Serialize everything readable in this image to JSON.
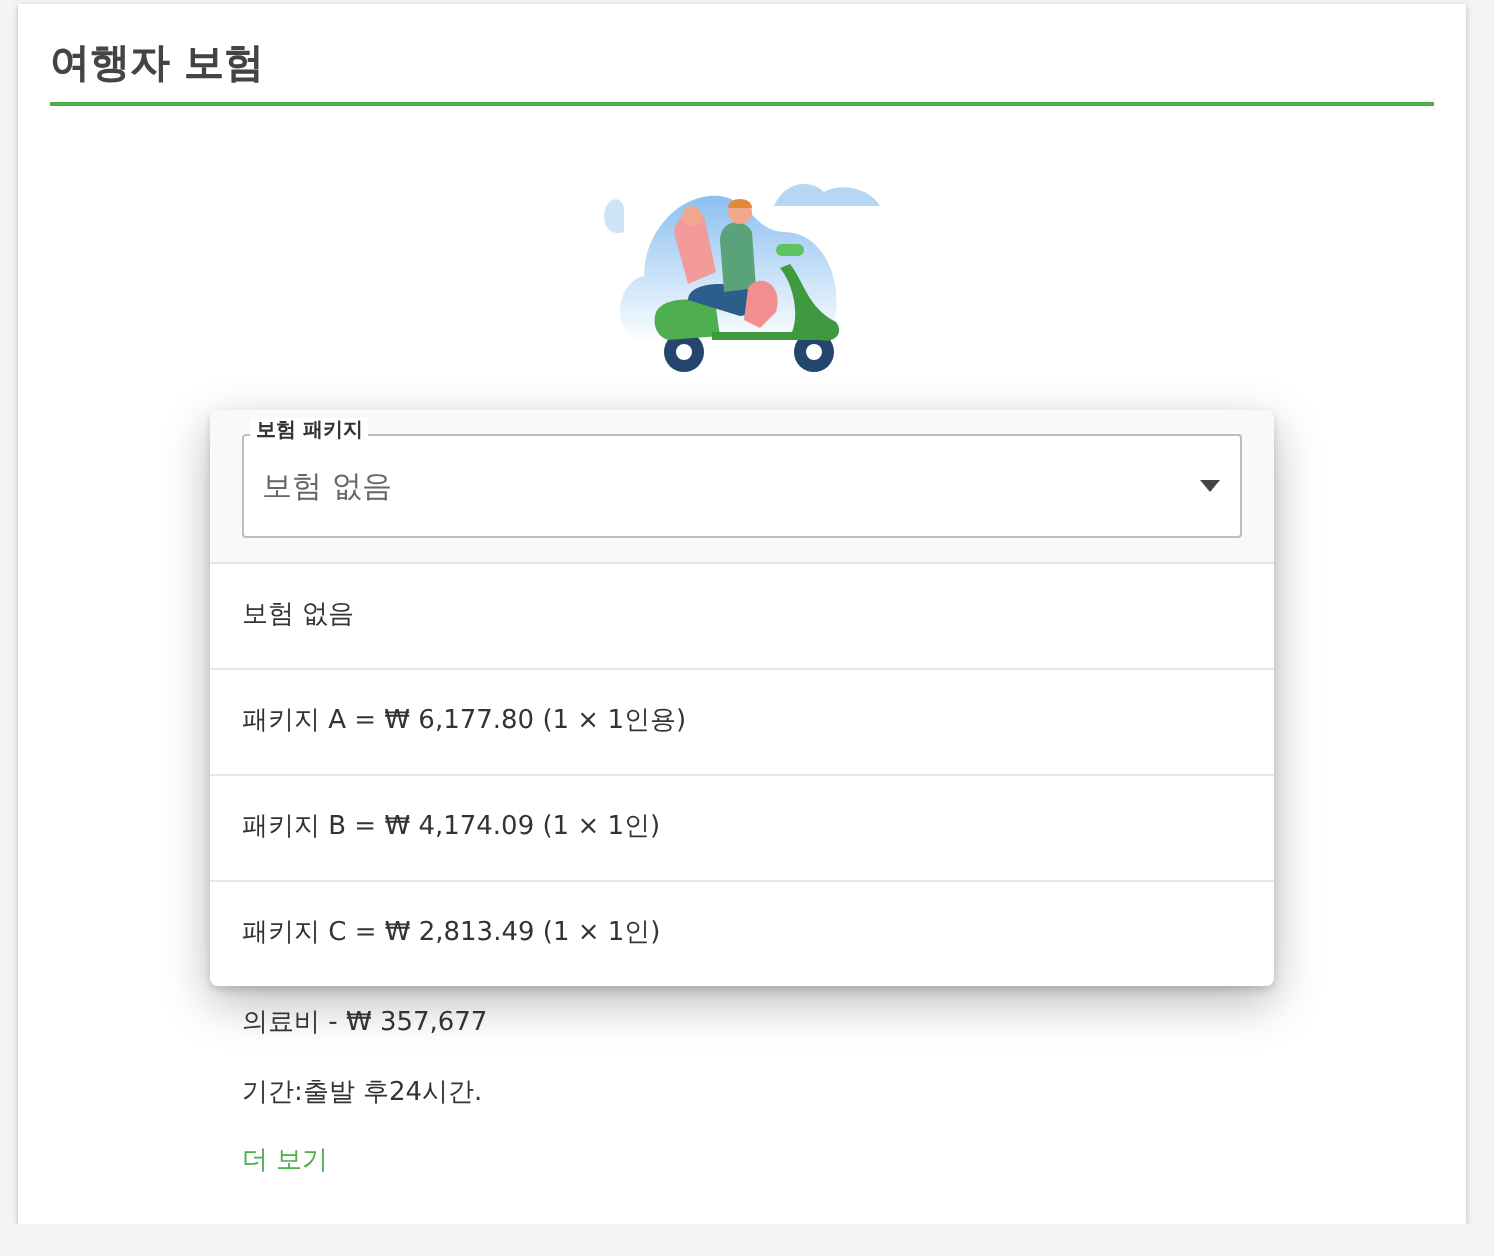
{
  "card": {
    "title": "여행자 보험"
  },
  "coverage": [
    "의료비 - ₩ 357,677"
  ],
  "period": "기간:출발 후24시간.",
  "more_link": "더 보기",
  "dropdown": {
    "label": "보험 패키지",
    "value": "보험 없음",
    "expanded": true,
    "options": [
      {
        "label": "보험 없음"
      },
      {
        "label": "패키지 A = ₩ 6,177.80 (1 × 1인용)"
      },
      {
        "label": "패키지 B = ₩ 4,174.09 (1 × 1인)"
      },
      {
        "label": "패키지 C = ₩ 2,813.49 (1 × 1인)"
      }
    ]
  }
}
